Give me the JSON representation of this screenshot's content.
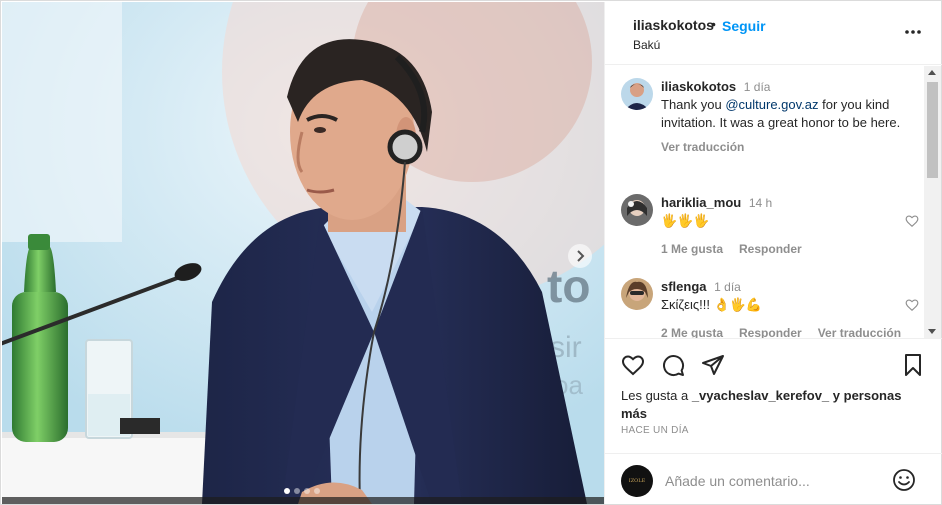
{
  "post": {
    "username": "iliaskokotos",
    "separator": "•",
    "follow_label": "Seguir",
    "location": "Bakú",
    "more_icon": "more-horizontal-icon"
  },
  "photo": {
    "carousel_dots": 4,
    "active_dot": 1,
    "next_icon": "chevron-right-icon"
  },
  "comments": [
    {
      "username": "iliaskokotos",
      "time": "1 día",
      "text_before": "Thank you ",
      "mention": "@culture.gov.az",
      "text_after": " for you kind invitation. It was a great honor to be here.",
      "translate_label": "Ver traducción"
    },
    {
      "username": "hariklia_mou",
      "time": "14 h",
      "text": "🖐🖐🖐",
      "likes_label": "1 Me gusta",
      "reply_label": "Responder"
    },
    {
      "username": "sflenga",
      "time": "1 día",
      "text": "Σκίζεις!!! 👌🖐💪",
      "likes_label": "2 Me gusta",
      "reply_label": "Responder",
      "translate_label": "Ver traducción"
    }
  ],
  "actions": {
    "likes_prefix": "Les gusta a ",
    "likes_user": "_vyacheslav_kerefov_",
    "likes_suffix": " y personas más",
    "time_ago": "HACE UN DÍA"
  },
  "add_comment": {
    "placeholder": "Añade un comentario...",
    "avatar_text": "IZOLE"
  }
}
